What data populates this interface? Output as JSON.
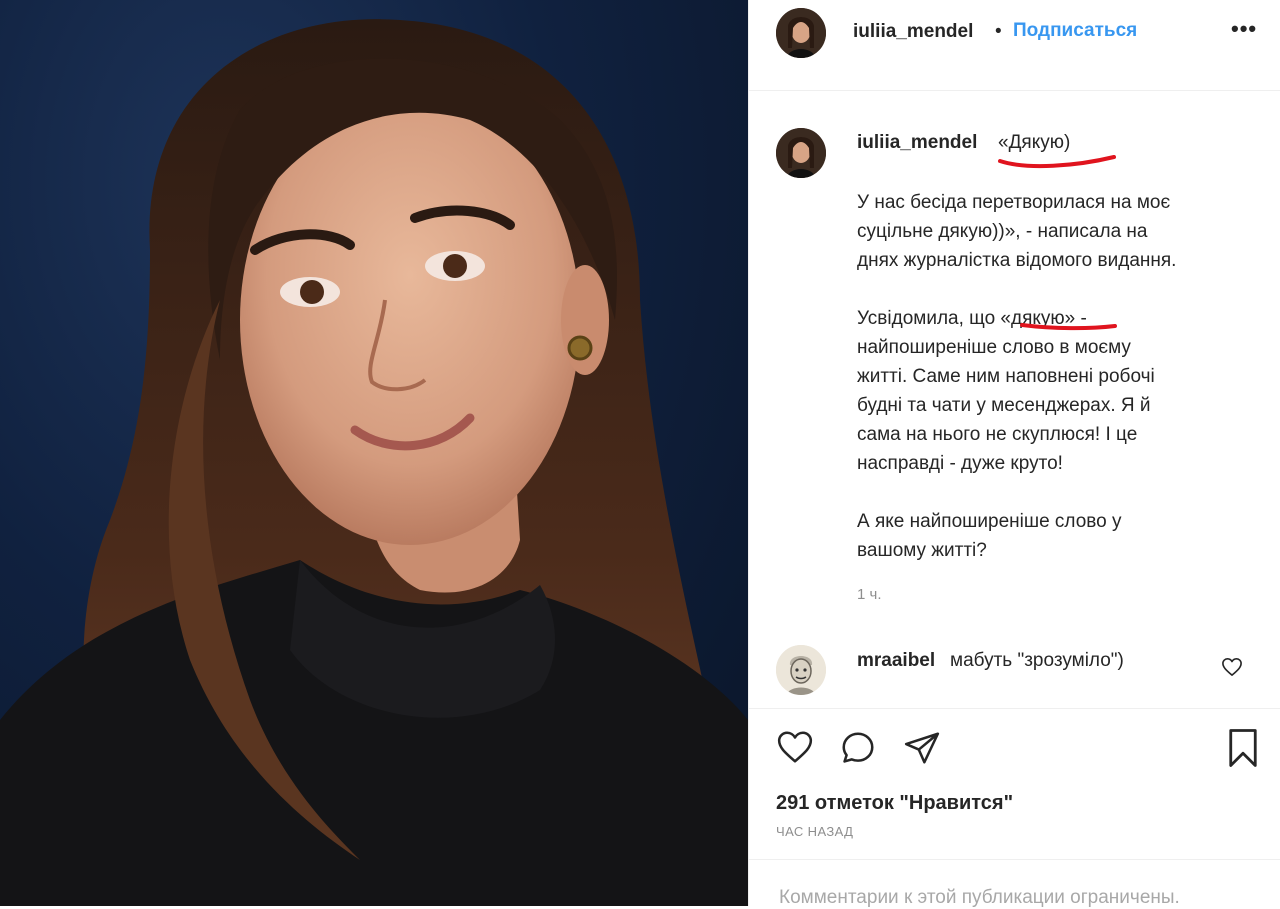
{
  "photo": {
    "alt": "portrait"
  },
  "header": {
    "username": "iuliia_mendel",
    "separator": "•",
    "follow_label": "Подписаться",
    "more_label": "•••"
  },
  "caption": {
    "username": "iuliia_mendel",
    "first_line": "«Дякую)",
    "paragraphs": [
      [
        "У нас бесіда перетворилася на моє",
        "суцільне дякую))», - написала на",
        "днях журналістка відомого видання."
      ],
      [
        "Усвідомила, що «дякую» -",
        "найпоширеніше слово в моєму",
        "житті. Саме ним наповнені робочі",
        "будні та чати у месенджерах. Я й",
        "сама на нього не скуплюся! І це",
        "насправді - дуже круто!"
      ],
      [
        "А яке найпоширеніше слово у",
        "вашому житті?"
      ]
    ],
    "time": "1 ч."
  },
  "comment": {
    "username": "mraaibel",
    "text": "мабуть \"зрозуміло\")"
  },
  "actions": {
    "likes": "291 отметок \"Нравится\"",
    "time_ago": "ЧАС НАЗАД",
    "restricted": "Комментарии к этой публикации ограничены."
  },
  "colors": {
    "link": "#3897f0",
    "annotation_underline": "#e0141e",
    "muted": "#8e8e8e"
  }
}
